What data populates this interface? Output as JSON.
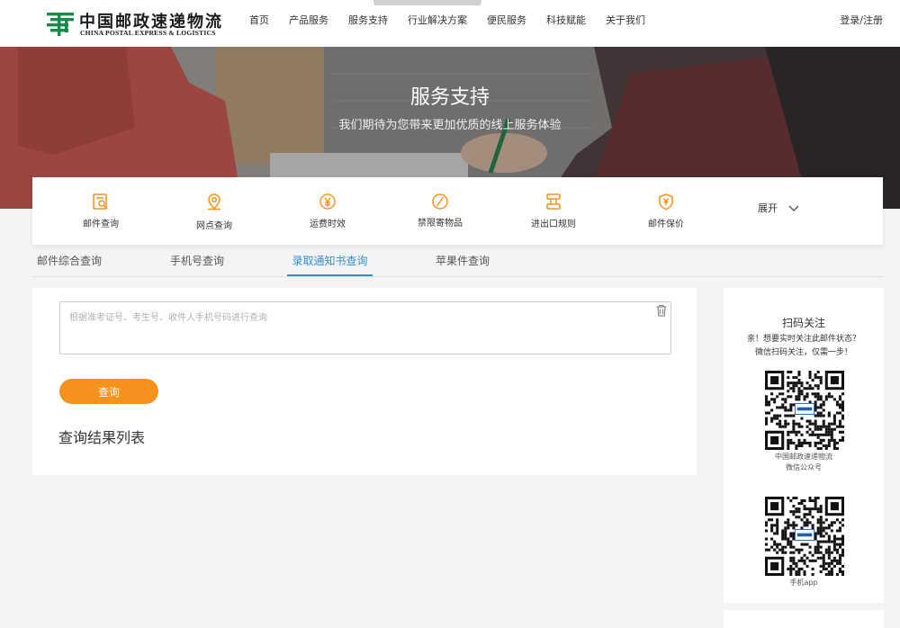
{
  "header": {
    "logo_cn": "中国邮政速递物流",
    "logo_en": "CHINA POSTAL EXPRESS & LOGISTICS",
    "nav": [
      "首页",
      "产品服务",
      "服务支持",
      "行业解决方案",
      "便民服务",
      "科技赋能",
      "关于我们"
    ],
    "login": "登录/注册"
  },
  "banner": {
    "title": "服务支持",
    "subtitle": "我们期待为您带来更加优质的线上服务体验"
  },
  "services": {
    "items": [
      {
        "label": "邮件查询",
        "icon": "mail-search-icon"
      },
      {
        "label": "网点查询",
        "icon": "location-pin-icon"
      },
      {
        "label": "运费时效",
        "icon": "yen-clock-icon"
      },
      {
        "label": "禁限寄物品",
        "icon": "forbidden-icon"
      },
      {
        "label": "进出口规则",
        "icon": "import-export-icon"
      },
      {
        "label": "邮件保价",
        "icon": "shield-yen-icon"
      }
    ],
    "expand": "展开",
    "accent": "#f5921e"
  },
  "tabs": [
    "邮件综合查询",
    "手机号查询",
    "录取通知书查询",
    "苹果件查询"
  ],
  "active_tab": "录取通知书查询",
  "query": {
    "placeholder": "根据准考证号、考生号、收件人手机号码进行查询",
    "value": "",
    "button": "查询",
    "result_title": "查询结果列表"
  },
  "side": {
    "title": "扫码关注",
    "desc_line1": "亲！想要实时关注此邮件状态？",
    "desc_line2": "微信扫码关注，仅需一步！",
    "qr1_caption_line1": "中国邮政速递物流",
    "qr1_caption_line2": "微信公众号",
    "qr2_caption": "手机app"
  },
  "colors": {
    "accent": "#f5921e",
    "link_blue": "#2f8fcf",
    "brand_green": "#1a8a4a"
  }
}
